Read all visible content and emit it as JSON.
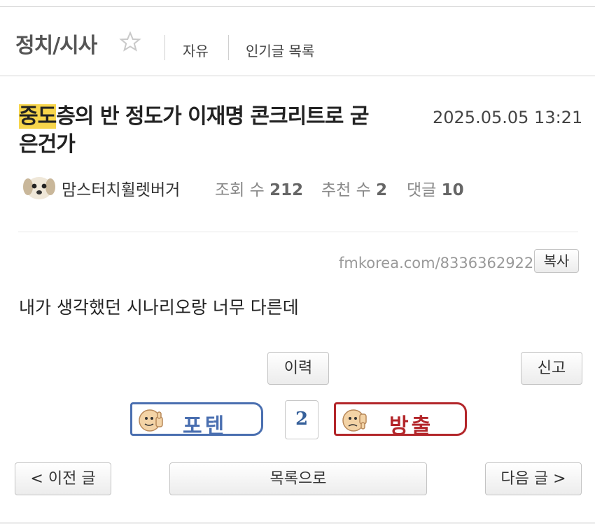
{
  "header": {
    "board_title": "정치/시사",
    "links": [
      "자유",
      "인기글 목록"
    ]
  },
  "post": {
    "title_highlight": "중도",
    "title_rest_line1": "층의 반 정도가 이재명 콘크리트로 굳",
    "title_line2": "은건가",
    "date": "2025.05.05 13:21",
    "author": "맘스터치휠렛버거",
    "views_label": "조회 수",
    "views": "212",
    "recommend_label": "추천 수",
    "recommend": "2",
    "comments_label": "댓글",
    "comments": "10",
    "url": "fmkorea.com/8336362922",
    "copy_label": "복사",
    "content": "내가 생각했던 시나리오랑 너무 다른데"
  },
  "actions": {
    "history_label": "이력",
    "report_label": "신고",
    "upvote_label": "포텐",
    "vote_count": "2",
    "downvote_label": "방출"
  },
  "nav": {
    "prev_label": "< 이전 글",
    "list_label": "목록으로",
    "next_label": "다음 글 >"
  },
  "colors": {
    "highlight": "#f7d54b",
    "upvote": "#4a6fb0",
    "downvote": "#b3262a"
  }
}
